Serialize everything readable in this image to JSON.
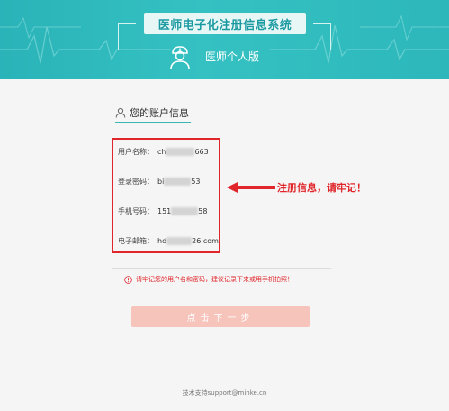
{
  "header": {
    "system_title": "医师电子化注册信息系统",
    "edition": "医师个人版"
  },
  "section": {
    "title": "您的账户信息"
  },
  "account": {
    "fields": [
      {
        "label": "用户名称：",
        "value_start": "ch",
        "value_end": "663"
      },
      {
        "label": "登录密码：",
        "value_start": "bi",
        "value_end": "53"
      },
      {
        "label": "手机号码：",
        "value_start": "151",
        "value_end": "58"
      },
      {
        "label": "电子邮箱：",
        "value_start": "hd",
        "value_end": "26.com"
      }
    ]
  },
  "annotation": {
    "text": "注册信息，请牢记！"
  },
  "warning": {
    "text": "请牢记您的用户名和密码，建议记录下来或用手机拍照！"
  },
  "actions": {
    "next_label": "点击下一步"
  },
  "footer": {
    "support": "技术支持support@minke.cn"
  },
  "colors": {
    "header_teal": "#35c1c2",
    "accent_red": "#e0252b",
    "button_disabled": "#f7c4bb",
    "tab_underline": "#3ab7b3"
  }
}
